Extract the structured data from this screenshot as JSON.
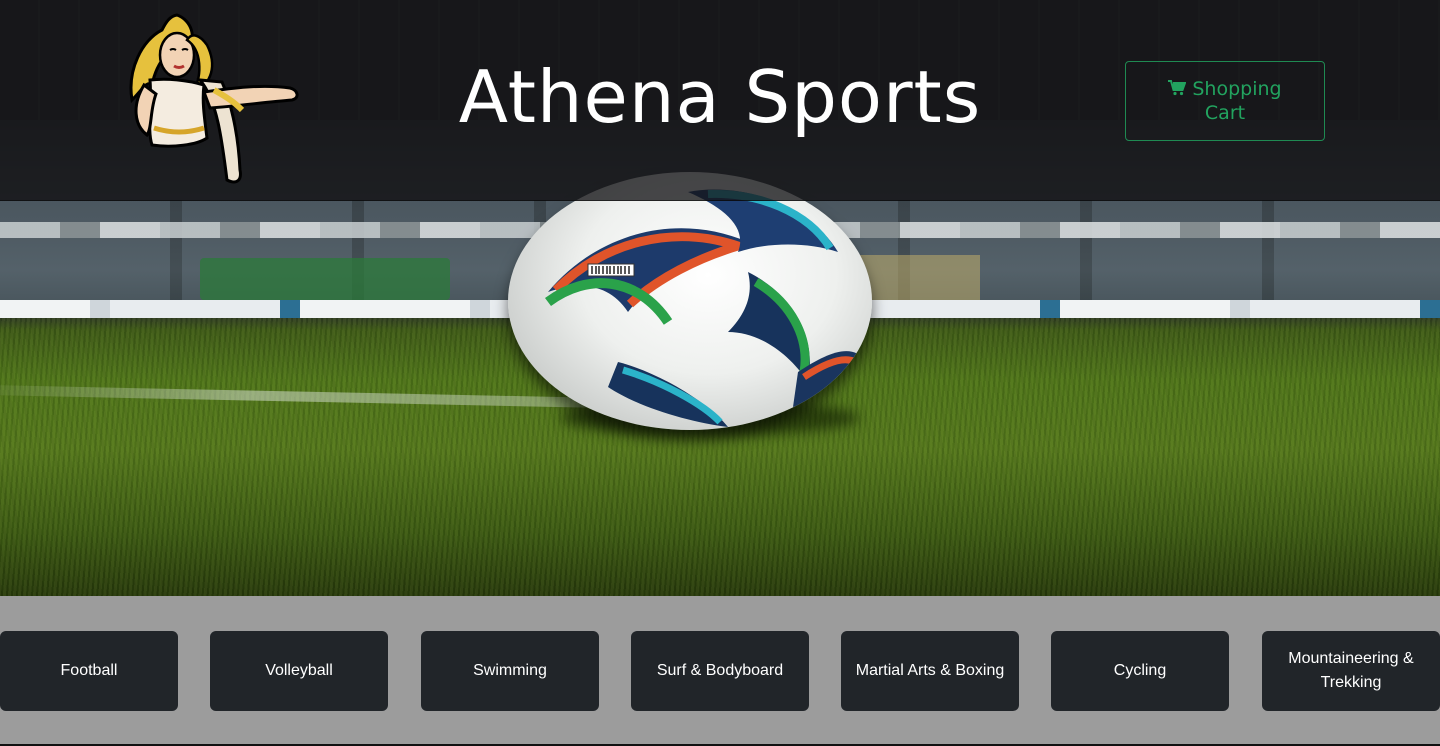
{
  "header": {
    "title": "Athena Sports",
    "logo_icon": "athena-goddess-logo",
    "cart": {
      "label": "Shopping Cart",
      "icon": "cart-icon",
      "color": "#22a35f"
    }
  },
  "hero": {
    "image": "soccer-ball-on-stadium-pitch"
  },
  "categories": {
    "items": [
      {
        "label": "Football"
      },
      {
        "label": "Volleyball"
      },
      {
        "label": "Swimming"
      },
      {
        "label": "Surf & Bodyboard"
      },
      {
        "label": "Martial Arts & Boxing"
      },
      {
        "label": "Cycling"
      },
      {
        "label": "Mountaineering & Trekking"
      }
    ],
    "button_color": "#212529",
    "strip_color": "#9c9c9c"
  }
}
